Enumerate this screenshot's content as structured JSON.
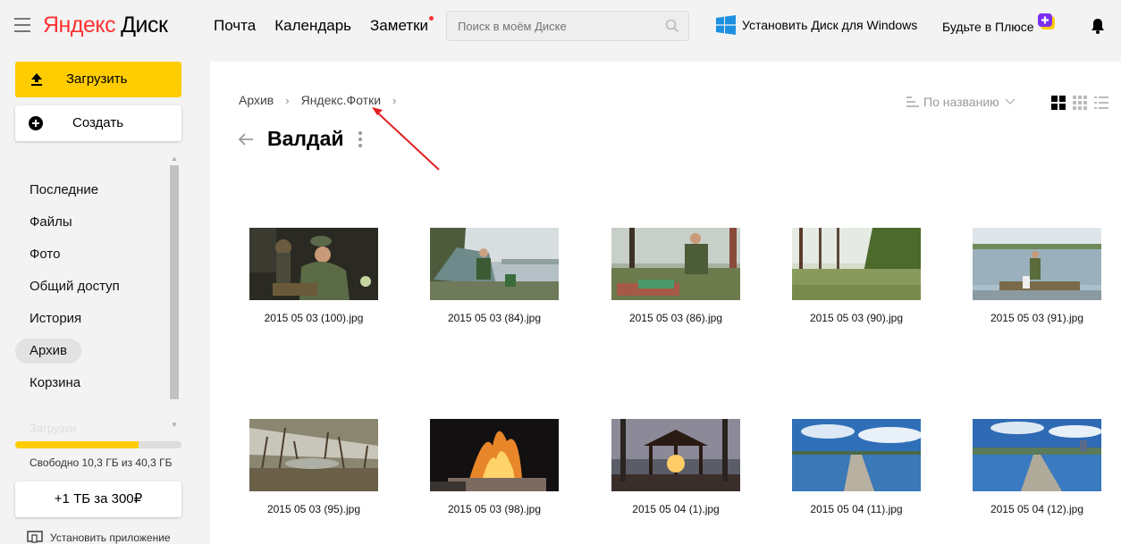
{
  "header": {
    "logo_ya": "Яндекс",
    "logo_disk": "Диск",
    "nav": [
      {
        "label": "Почта"
      },
      {
        "label": "Календарь"
      },
      {
        "label": "Заметки"
      }
    ],
    "search_placeholder": "Поиск в моём Диске",
    "install_windows": "Установить Диск для Windows",
    "plus_label": "Будьте в Плюсе"
  },
  "sidebar": {
    "upload_label": "Загрузить",
    "create_label": "Создать",
    "items": [
      {
        "label": "Последние"
      },
      {
        "label": "Файлы"
      },
      {
        "label": "Фото"
      },
      {
        "label": "Общий доступ"
      },
      {
        "label": "История"
      },
      {
        "label": "Архив"
      },
      {
        "label": "Корзина"
      }
    ],
    "active_index": 5,
    "faded_item": "Загрузки",
    "storage_text": "Свободно 10,3 ГБ из 40,3 ГБ",
    "storage_used_fraction": 0.74,
    "upgrade_label": "+1 ТБ за 300₽",
    "install_app_label": "Установить приложение"
  },
  "main": {
    "breadcrumb": [
      {
        "label": "Архив"
      },
      {
        "label": "Яндекс.Фотки"
      }
    ],
    "title": "Валдай",
    "sort_label": "По названию",
    "files": [
      {
        "name": "2015 05 03 (100).jpg"
      },
      {
        "name": "2015 05 03 (84).jpg"
      },
      {
        "name": "2015 05 03 (86).jpg"
      },
      {
        "name": "2015 05 03 (90).jpg"
      },
      {
        "name": "2015 05 03 (91).jpg"
      },
      {
        "name": "2015 05 03 (95).jpg"
      },
      {
        "name": "2015 05 03 (98).jpg"
      },
      {
        "name": "2015 05 04 (1).jpg"
      },
      {
        "name": "2015 05 04 (11).jpg"
      },
      {
        "name": "2015 05 04 (12).jpg"
      }
    ]
  },
  "colors": {
    "accent": "#ffcc00",
    "brand_red": "#ff3333",
    "annotation_arrow": "#e02020"
  }
}
